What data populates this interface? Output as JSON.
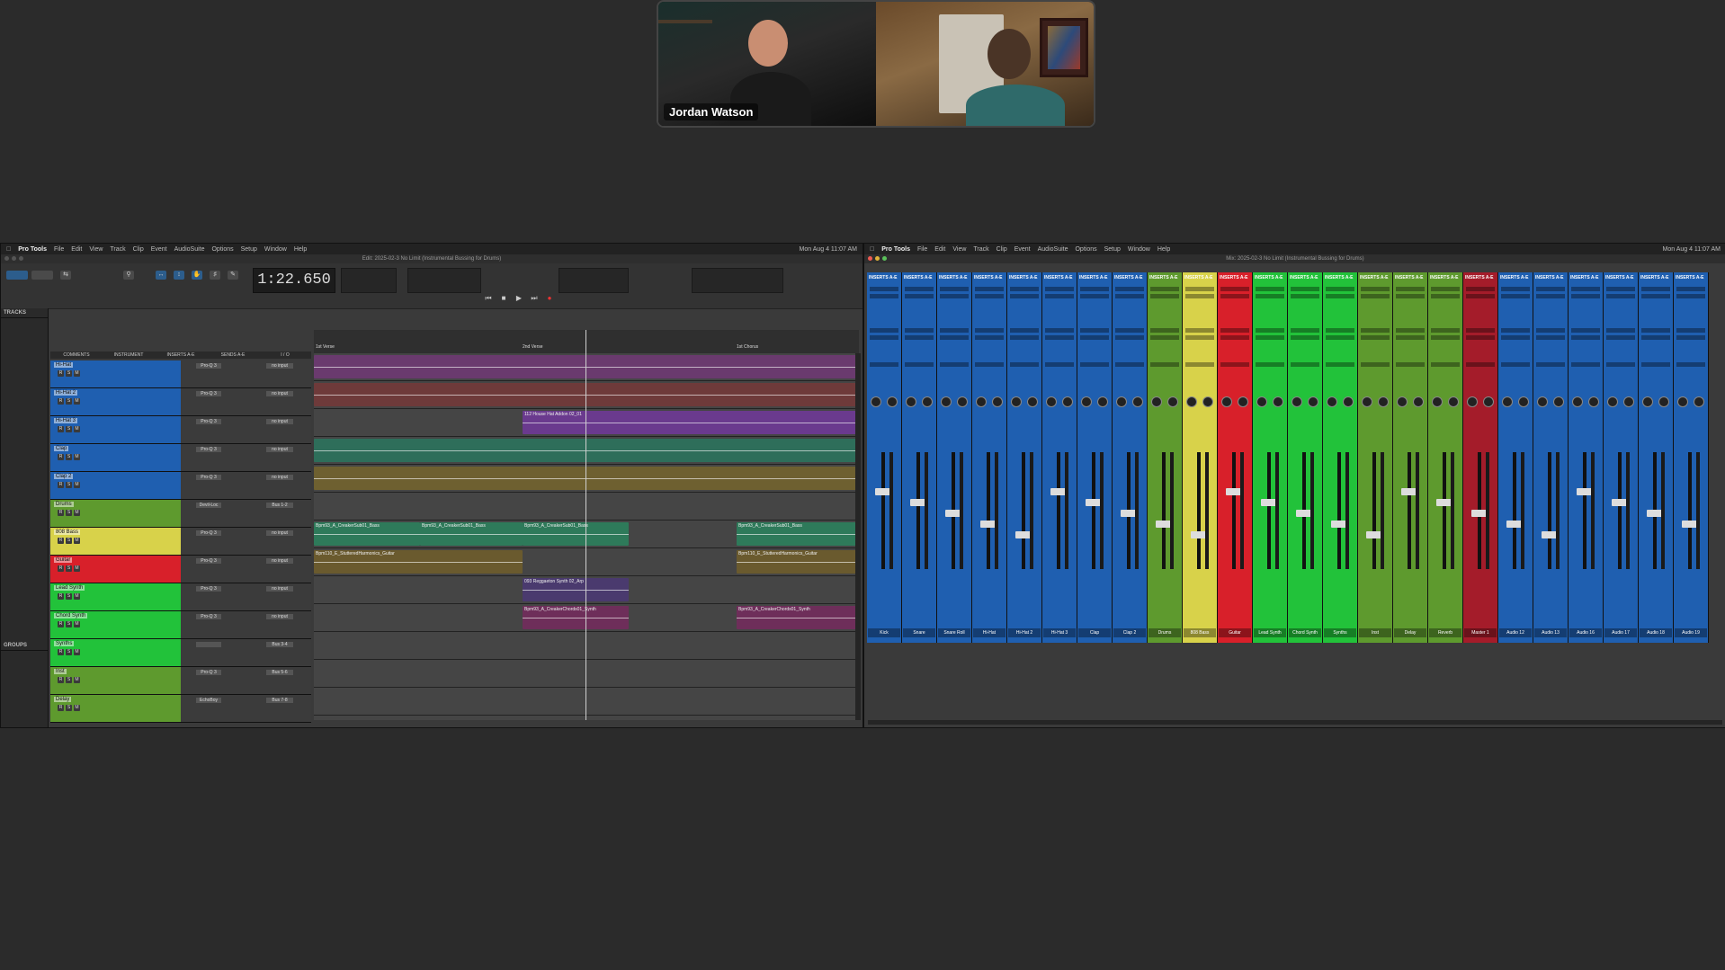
{
  "video_call": {
    "participant_1_name": "Jordan Watson"
  },
  "edit_window": {
    "menu": [
      "Pro Tools",
      "File",
      "Edit",
      "View",
      "Track",
      "Clip",
      "Event",
      "AudioSuite",
      "Options",
      "Setup",
      "Window",
      "Help"
    ],
    "clock": "Mon Aug 4  11:07 AM",
    "title": "Edit: 2025-02-3 No Limit (Instrumental Bussing for Drums)",
    "counter": "1:22.650",
    "tracks_label": "TRACKS",
    "groups_label": "GROUPS",
    "column_headers": [
      "COMMENTS",
      "INSTRUMENT",
      "INSERTS A-E",
      "SENDS A-E",
      "I / O"
    ],
    "markers": [
      "1st Verse",
      "2nd Verse",
      "1st Chorus"
    ],
    "tracks": [
      {
        "name": "Hi-Hat",
        "color": "#1f5fb0",
        "insert": "Pro-Q 3",
        "io": "no input"
      },
      {
        "name": "Hi-Hat 2",
        "color": "#1f5fb0",
        "insert": "Pro-Q 3",
        "io": "no input"
      },
      {
        "name": "Hi-Hat 3",
        "color": "#1f5fb0",
        "insert": "Pro-Q 3",
        "io": "no input"
      },
      {
        "name": "Clap",
        "color": "#1f5fb0",
        "insert": "Pro-Q 3",
        "io": "no input"
      },
      {
        "name": "Clap 2",
        "color": "#1f5fb0",
        "insert": "Pro-Q 3",
        "io": "no input"
      },
      {
        "name": "Drums",
        "color": "#5e9a2e",
        "insert": "Devil-Loc",
        "io": "Bus 1-2"
      },
      {
        "name": "808 Bass",
        "color": "#d8d24a",
        "insert": "Pro-Q 3",
        "io": "no input"
      },
      {
        "name": "Guitar",
        "color": "#d8202a",
        "insert": "Pro-Q 3",
        "io": "no input"
      },
      {
        "name": "Lead Synth",
        "color": "#22c23a",
        "insert": "Pro-Q 3",
        "io": "no input"
      },
      {
        "name": "Chord Synth",
        "color": "#22c23a",
        "insert": "Pro-Q 3",
        "io": "no input"
      },
      {
        "name": "Synths",
        "color": "#22c23a",
        "insert": "",
        "io": "Bus 3-4"
      },
      {
        "name": "Inst",
        "color": "#5e9a2e",
        "insert": "Pro-Q 3",
        "io": "Bus 5-6"
      },
      {
        "name": "Delay",
        "color": "#5e9a2e",
        "insert": "EchoBoy",
        "io": "Bus 7-8"
      }
    ],
    "clips": {
      "hihat3": "112 House Hat Addon 02_01",
      "bass": "Bpm93_A_CreakerSub01_Bass",
      "guitar": "Bpm110_E_StutteredHarmonics_Guitar",
      "lead": "093 Reggaeton Synth 02_Arp",
      "chord": "Bpm93_A_CreakerChords01_Synth"
    }
  },
  "mix_window": {
    "menu": [
      "Pro Tools",
      "File",
      "Edit",
      "View",
      "Track",
      "Clip",
      "Event",
      "AudioSuite",
      "Options",
      "Setup",
      "Window",
      "Help"
    ],
    "clock": "Mon Aug 4  11:07 AM",
    "title": "Mix: 2025-02-3 No Limit (Instrumental Bussing for Drums)",
    "insert_header": "INSERTS A-E",
    "channels": [
      {
        "name": "Kick",
        "color": "#1f5fb0"
      },
      {
        "name": "Snare",
        "color": "#1f5fb0"
      },
      {
        "name": "Snare Roll",
        "color": "#1f5fb0"
      },
      {
        "name": "Hi-Hat",
        "color": "#1f5fb0"
      },
      {
        "name": "Hi-Hat 2",
        "color": "#1f5fb0"
      },
      {
        "name": "Hi-Hat 3",
        "color": "#1f5fb0"
      },
      {
        "name": "Clap",
        "color": "#1f5fb0"
      },
      {
        "name": "Clap 2",
        "color": "#1f5fb0"
      },
      {
        "name": "Drums",
        "color": "#5e9a2e"
      },
      {
        "name": "808 Bass",
        "color": "#d8d24a"
      },
      {
        "name": "Guitar",
        "color": "#d8202a"
      },
      {
        "name": "Lead Synth",
        "color": "#22c23a"
      },
      {
        "name": "Chord Synth",
        "color": "#22c23a"
      },
      {
        "name": "Synths",
        "color": "#22c23a"
      },
      {
        "name": "Inst",
        "color": "#5e9a2e"
      },
      {
        "name": "Delay",
        "color": "#5e9a2e"
      },
      {
        "name": "Reverb",
        "color": "#5e9a2e"
      },
      {
        "name": "Master 1",
        "color": "#a41c2a"
      },
      {
        "name": "Audio 12",
        "color": "#1f5fb0"
      },
      {
        "name": "Audio 13",
        "color": "#1f5fb0"
      },
      {
        "name": "Audio 16",
        "color": "#1f5fb0"
      },
      {
        "name": "Audio 17",
        "color": "#1f5fb0"
      },
      {
        "name": "Audio 18",
        "color": "#1f5fb0"
      },
      {
        "name": "Audio 19",
        "color": "#1f5fb0"
      }
    ]
  }
}
